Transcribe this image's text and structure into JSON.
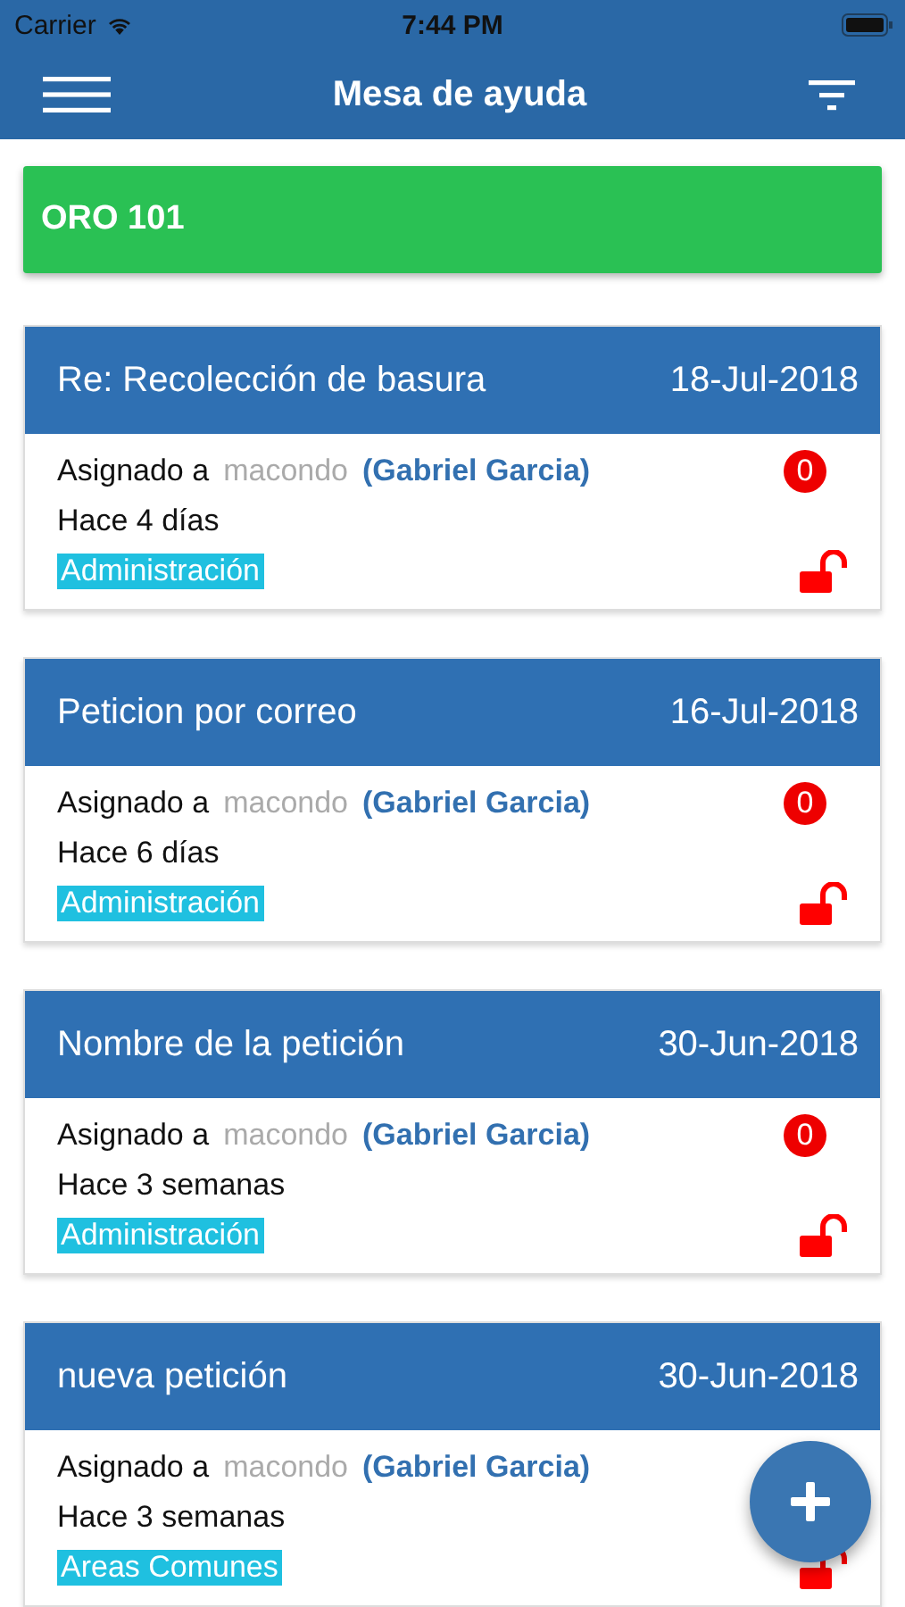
{
  "status_bar": {
    "carrier": "Carrier",
    "time": "7:44 PM"
  },
  "nav": {
    "title": "Mesa de ayuda"
  },
  "group": {
    "title": "ORO 101"
  },
  "tickets": [
    {
      "title": "Re: Recolección de basura",
      "date": "18-Jul-2018",
      "assigned_label": "Asignado a",
      "user": "macondo",
      "name": "(Gabriel Garcia)",
      "age": "Hace 4 días",
      "category": "Administración",
      "count": "0",
      "locked": false
    },
    {
      "title": "Peticion por correo",
      "date": "16-Jul-2018",
      "assigned_label": "Asignado a",
      "user": "macondo",
      "name": "(Gabriel Garcia)",
      "age": "Hace 6 días",
      "category": "Administración",
      "count": "0",
      "locked": false
    },
    {
      "title": "Nombre de la petición",
      "date": "30-Jun-2018",
      "assigned_label": "Asignado a",
      "user": "macondo",
      "name": "(Gabriel Garcia)",
      "age": "Hace 3 semanas",
      "category": "Administración",
      "count": "0",
      "locked": false
    },
    {
      "title": "nueva petición",
      "date": "30-Jun-2018",
      "assigned_label": "Asignado a",
      "user": "macondo",
      "name": "(Gabriel Garcia)",
      "age": "Hace 3 semanas",
      "category": "Areas Comunes",
      "locked": false
    }
  ]
}
